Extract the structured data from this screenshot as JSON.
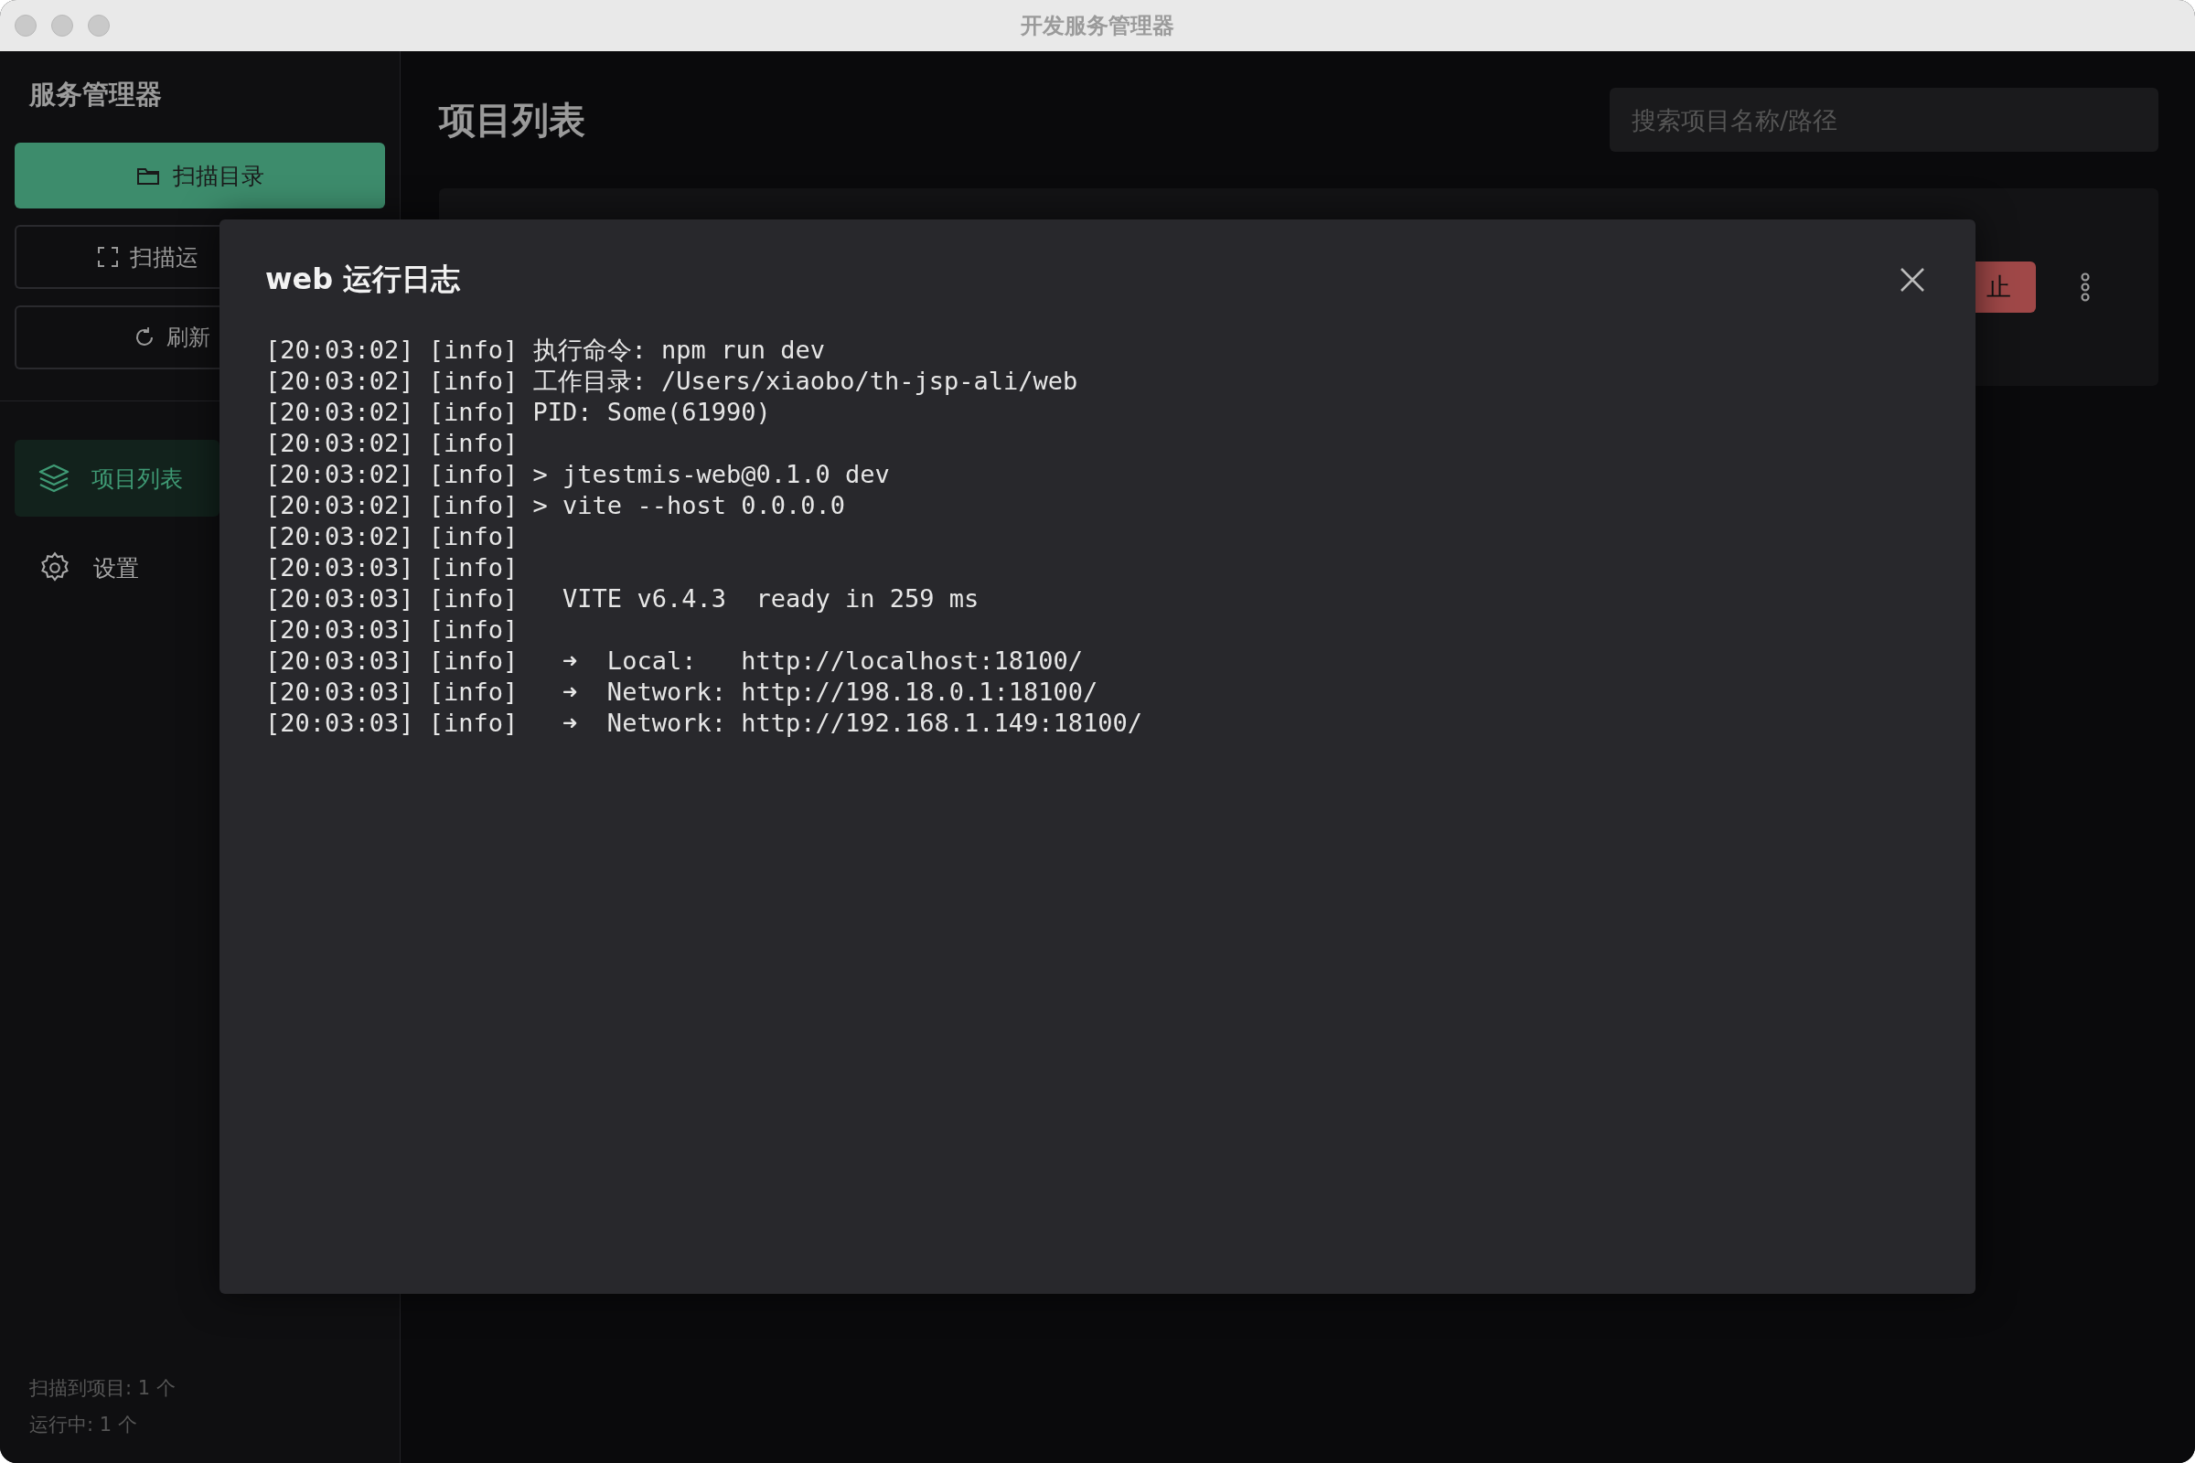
{
  "window": {
    "title": "开发服务管理器"
  },
  "sidebar": {
    "title": "服务管理器",
    "actions": [
      {
        "label": "扫描目录",
        "kind": "primary"
      },
      {
        "label": "扫描运",
        "kind": "outline"
      },
      {
        "label": "刷新",
        "kind": "outline"
      }
    ],
    "nav": [
      {
        "label": "项目列表",
        "selected": true
      },
      {
        "label": "设置",
        "selected": false
      }
    ],
    "footer": [
      "扫描到项目: 1 个",
      "运行中: 1 个"
    ]
  },
  "main": {
    "title": "项目列表",
    "search": {
      "placeholder": "搜索项目名称/路径"
    },
    "card": {
      "stop_button": "止"
    }
  },
  "dialog": {
    "title": "web 运行日志",
    "log": [
      "[20:03:02] [info] 执行命令: npm run dev",
      "[20:03:02] [info] 工作目录: /Users/xiaobo/th-jsp-ali/web",
      "[20:03:02] [info] PID: Some(61990)",
      "[20:03:02] [info]",
      "[20:03:02] [info] > jtestmis-web@0.1.0 dev",
      "[20:03:02] [info] > vite --host 0.0.0.0",
      "[20:03:02] [info]",
      "[20:03:03] [info]",
      "[20:03:03] [info]   VITE v6.4.3  ready in 259 ms",
      "[20:03:03] [info]",
      "[20:03:03] [info]   ➜  Local:   http://localhost:18100/",
      "[20:03:03] [info]   ➜  Network: http://198.18.0.1:18100/",
      "[20:03:03] [info]   ➜  Network: http://192.168.1.149:18100/"
    ]
  }
}
